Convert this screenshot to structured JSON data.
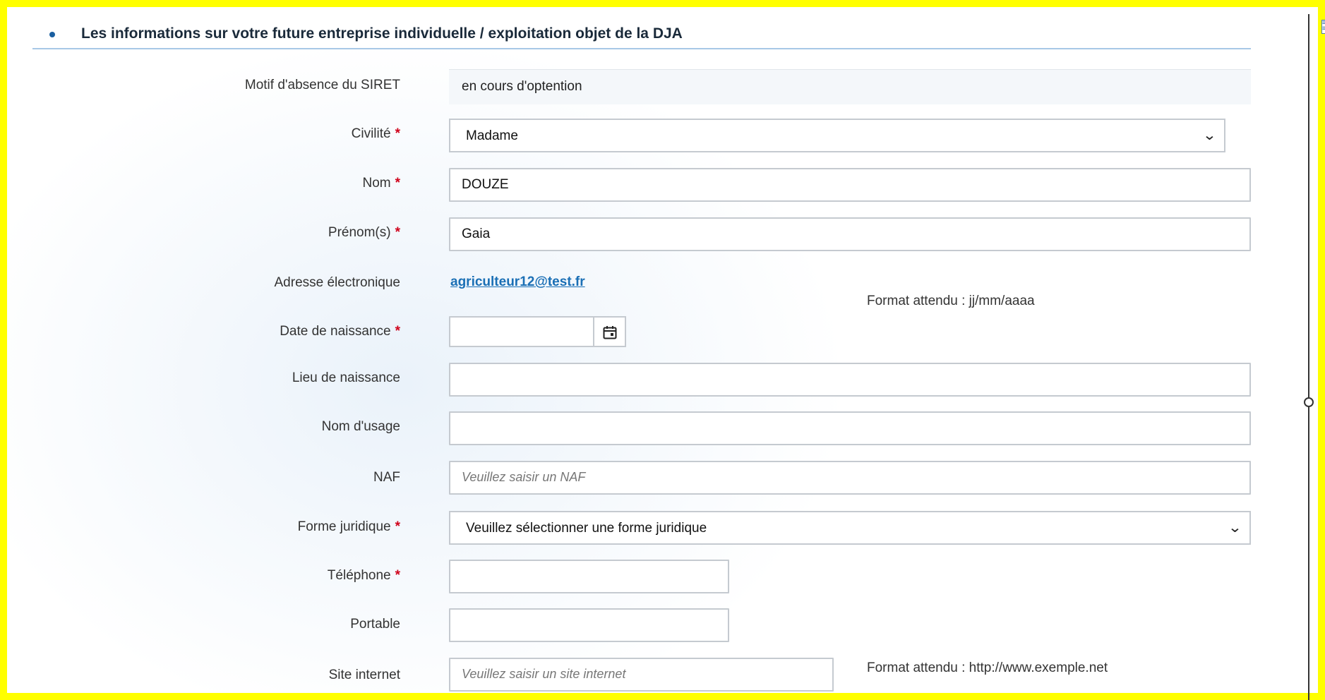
{
  "section": {
    "title": "Les informations sur votre future entreprise individuelle / exploitation objet de la DJA"
  },
  "form": {
    "siret_reason": {
      "label": "Motif d'absence du SIRET",
      "value": "en cours d'optention"
    },
    "civility": {
      "label": "Civilité",
      "required_mark": "*",
      "value": "Madame"
    },
    "last_name": {
      "label": "Nom",
      "required_mark": "*",
      "value": "DOUZE"
    },
    "first_names": {
      "label": "Prénom(s)",
      "required_mark": "*",
      "value": "Gaia"
    },
    "email": {
      "label": "Adresse électronique",
      "value": "agriculteur12@test.fr"
    },
    "birth_date": {
      "label": "Date de naissance",
      "required_mark": "*",
      "value": "",
      "hint": "Format attendu : jj/mm/aaaa"
    },
    "birth_place": {
      "label": "Lieu de naissance",
      "value": ""
    },
    "usage_name": {
      "label": "Nom d'usage",
      "value": ""
    },
    "naf": {
      "label": "NAF",
      "value": "",
      "placeholder": "Veuillez saisir un NAF"
    },
    "legal_form": {
      "label": "Forme juridique",
      "required_mark": "*",
      "value": "Veuillez sélectionner une forme juridique"
    },
    "phone": {
      "label": "Téléphone",
      "required_mark": "*",
      "value": ""
    },
    "mobile": {
      "label": "Portable",
      "value": ""
    },
    "website": {
      "label": "Site internet",
      "value": "",
      "placeholder": "Veuillez saisir un site internet",
      "hint": "Format attendu : http://www.exemple.net"
    }
  },
  "icons": {
    "section_bullet": "bullet-icon",
    "calendar": "calendar-icon",
    "select_chevron": "chevron-down-icon"
  },
  "colors": {
    "frame_highlight": "#ffff00",
    "required": "#d0021b",
    "link": "#1a6fb5",
    "accent": "#1a5fa0"
  }
}
